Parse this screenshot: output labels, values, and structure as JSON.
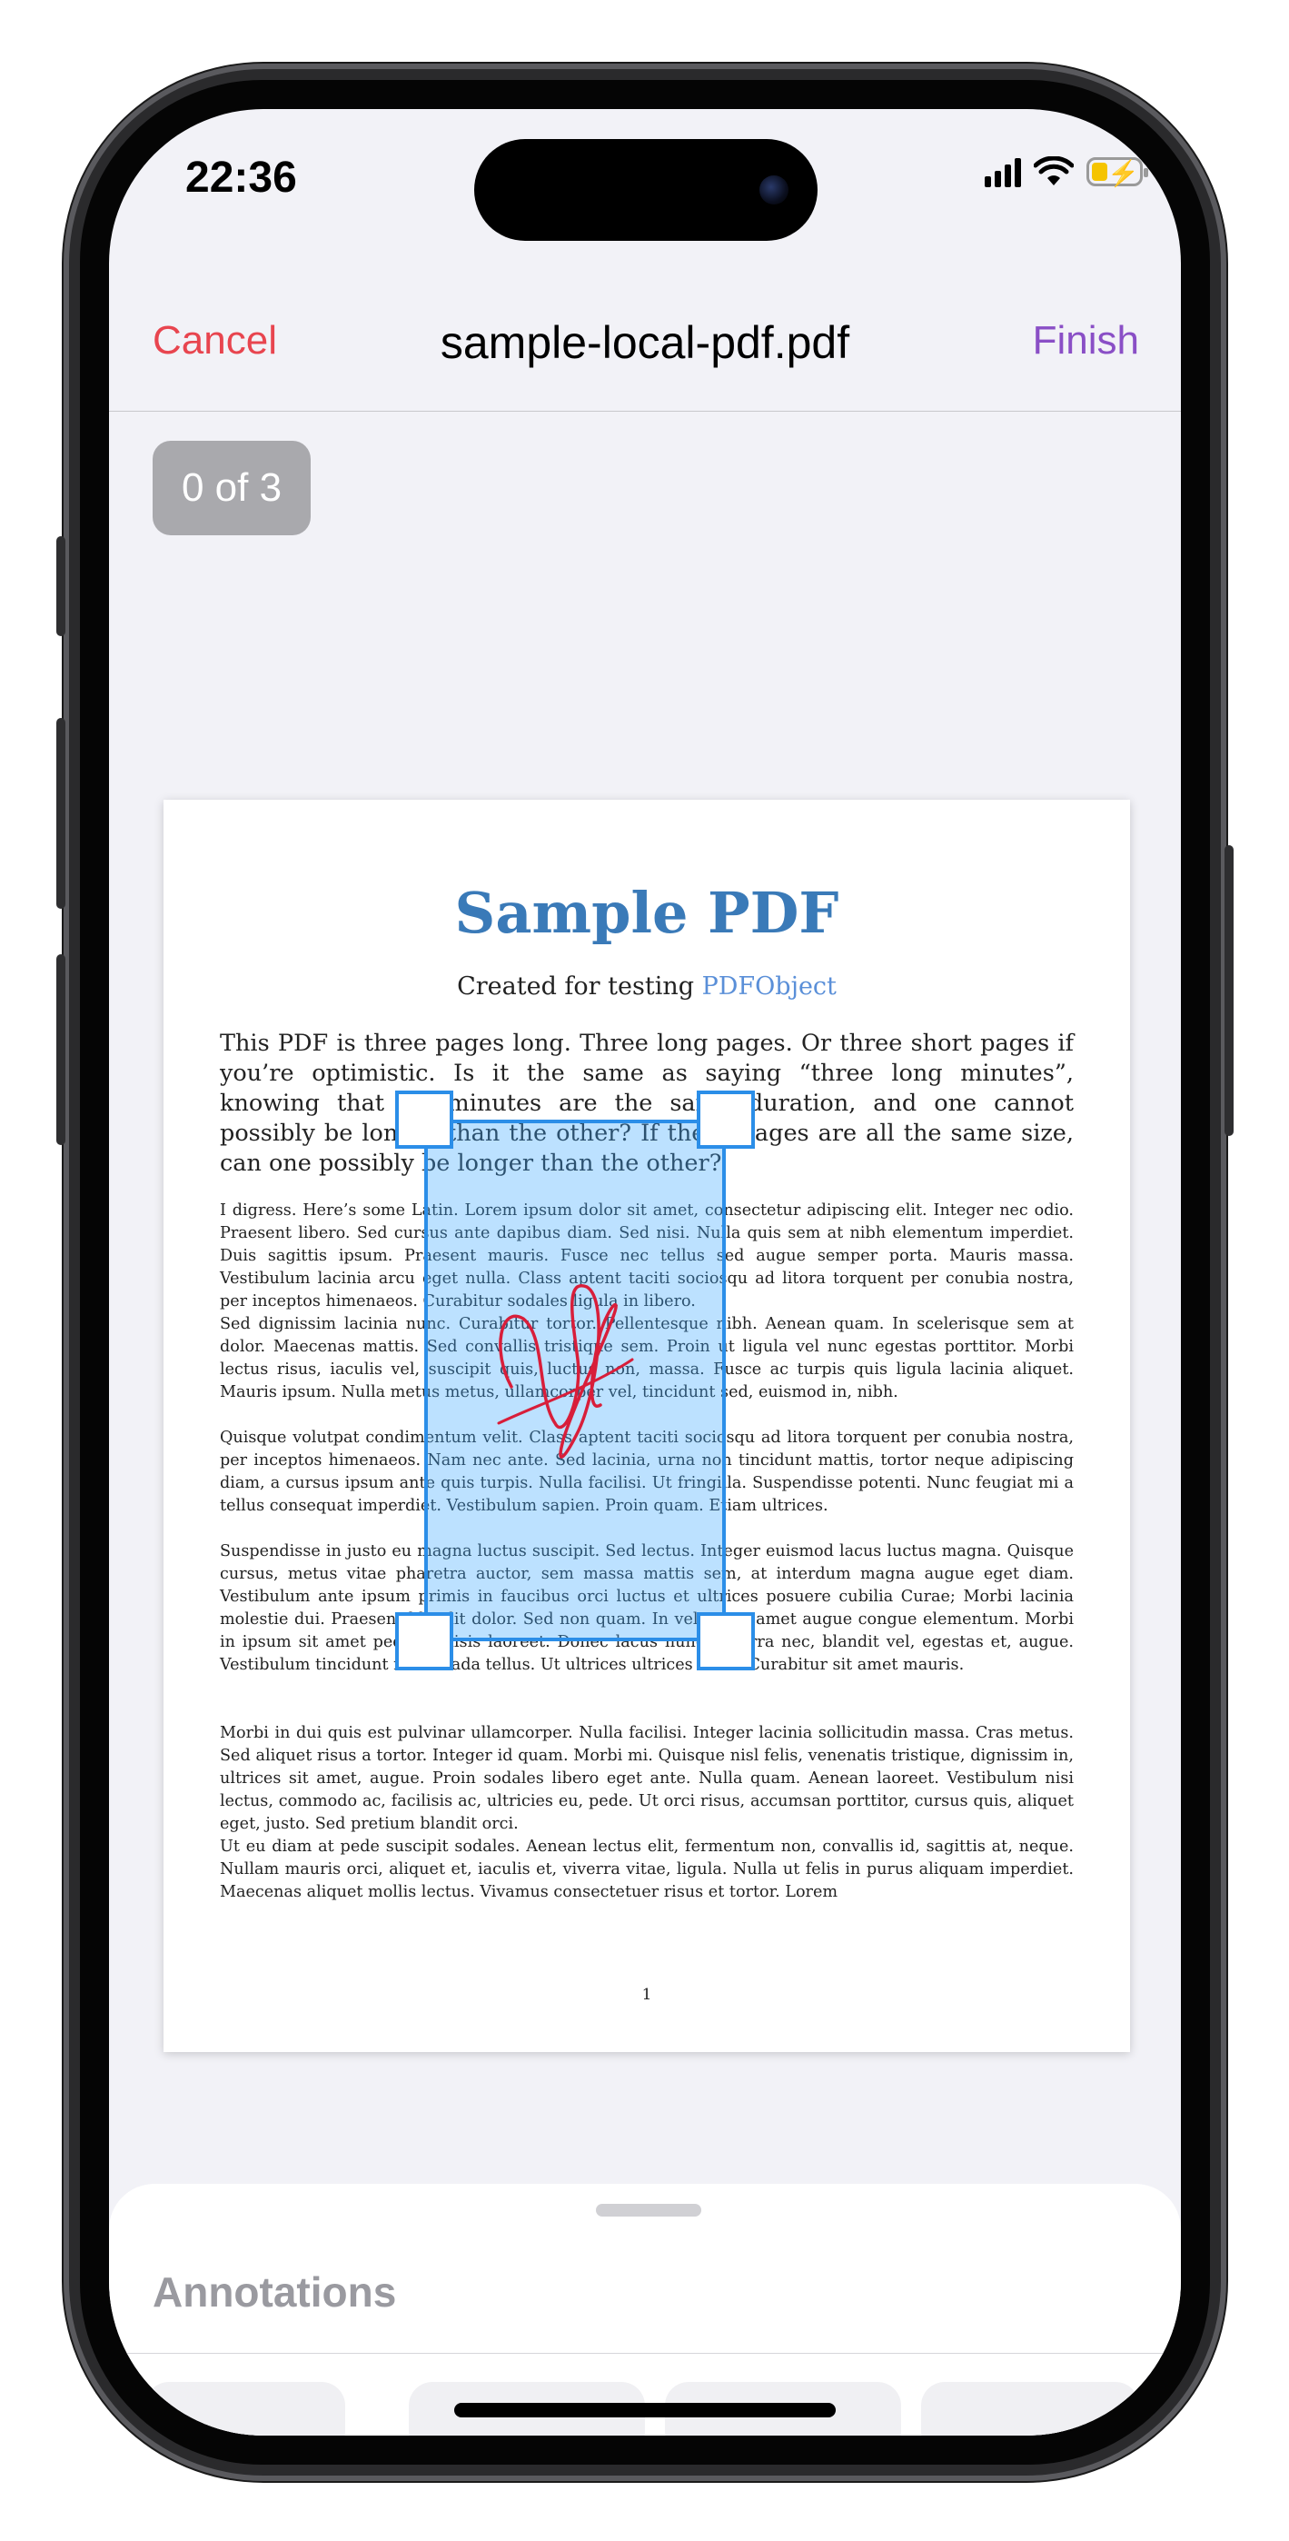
{
  "status_bar": {
    "time": "22:36"
  },
  "nav": {
    "cancel_label": "Cancel",
    "title": "sample-local-pdf.pdf",
    "finish_label": "Finish"
  },
  "page_counter": "0 of 3",
  "pdf": {
    "title": "Sample PDF",
    "subtitle_prefix": "Created for testing",
    "subtitle_link": "PDFObject",
    "lead": "This PDF is three pages long. Three long pages. Or three short pages if you’re optimistic. Is it the same as saying “three long minutes”, knowing that all minutes are the same duration, and one cannot possibly be longer than the other? If these pages are all the same size, can one possibly be longer than the other?",
    "paragraphs": [
      "I digress. Here’s some Latin. Lorem ipsum dolor sit amet, consectetur adipiscing elit. Integer nec odio. Praesent libero. Sed cursus ante dapibus diam. Sed nisi. Nulla quis sem at nibh elementum imperdiet. Duis sagittis ipsum. Praesent mauris. Fusce nec tellus sed augue semper porta. Mauris massa. Vestibulum lacinia arcu eget nulla. Class aptent taciti sociosqu ad litora torquent per conubia nostra, per inceptos himenaeos. Curabitur sodales ligula in libero.",
      "Sed dignissim lacinia nunc. Curabitur tortor. Pellentesque nibh. Aenean quam. In scelerisque sem at dolor. Maecenas mattis. Sed convallis tristique sem. Proin ut ligula vel nunc egestas porttitor. Morbi lectus risus, iaculis vel, suscipit quis, luctus non, massa. Fusce ac turpis quis ligula lacinia aliquet. Mauris ipsum. Nulla metus metus, ullamcorper vel, tincidunt sed, euismod in, nibh.",
      "Quisque volutpat condimentum velit. Class aptent taciti sociosqu ad litora torquent per conubia nostra, per inceptos himenaeos. Nam nec ante. Sed lacinia, urna non tincidunt mattis, tortor neque adipiscing diam, a cursus ipsum ante quis turpis. Nulla facilisi. Ut fringilla. Suspendisse potenti. Nunc feugiat mi a tellus consequat imperdiet. Vestibulum sapien. Proin quam. Etiam ultrices.",
      "Suspendisse in justo eu magna luctus suscipit. Sed lectus. Integer euismod lacus luctus magna. Quisque cursus, metus vitae pharetra auctor, sem massa mattis sem, at interdum magna augue eget diam. Vestibulum ante ipsum primis in faucibus orci luctus et ultrices posuere cubilia Curae; Morbi lacinia molestie dui. Praesent blandit dolor. Sed non quam. In vel mi sit amet augue congue elementum. Morbi in ipsum sit amet pede facilisis laoreet. Donec lacus nunc, viverra nec, blandit vel, egestas et, augue. Vestibulum tincidunt malesuada tellus. Ut ultrices ultrices enim. Curabitur sit amet mauris.",
      "Morbi in dui quis est pulvinar ullamcorper. Nulla facilisi. Integer lacinia sollicitudin massa. Cras metus. Sed aliquet risus a tortor. Integer id quam. Morbi mi. Quisque nisl felis, venenatis tristique, dignissim in, ultrices sit amet, augue. Proin sodales libero eget ante. Nulla quam. Aenean laoreet. Vestibulum nisi lectus, commodo ac, facilisis ac, ultricies eu, pede. Ut orci risus, accumsan porttitor, cursus quis, aliquet eget, justo. Sed pretium blandit orci.",
      "Ut eu diam at pede suscipit sodales. Aenean lectus elit, fermentum non, convallis id, sagittis at, neque. Nullam mauris orci, aliquet et, iaculis et, viverra vitae, ligula. Nulla ut felis in purus aliquam imperdiet. Maecenas aliquet mollis lectus. Vivamus consectetuer risus et tortor. Lorem"
    ],
    "page_number": "1"
  },
  "annotation": {
    "ink_color": "#d81e3a",
    "selection_color": "#2b8ee8"
  },
  "sheet": {
    "title": "Annotations"
  },
  "colors": {
    "cancel": "#e8454f",
    "finish": "#8a4fc6"
  }
}
